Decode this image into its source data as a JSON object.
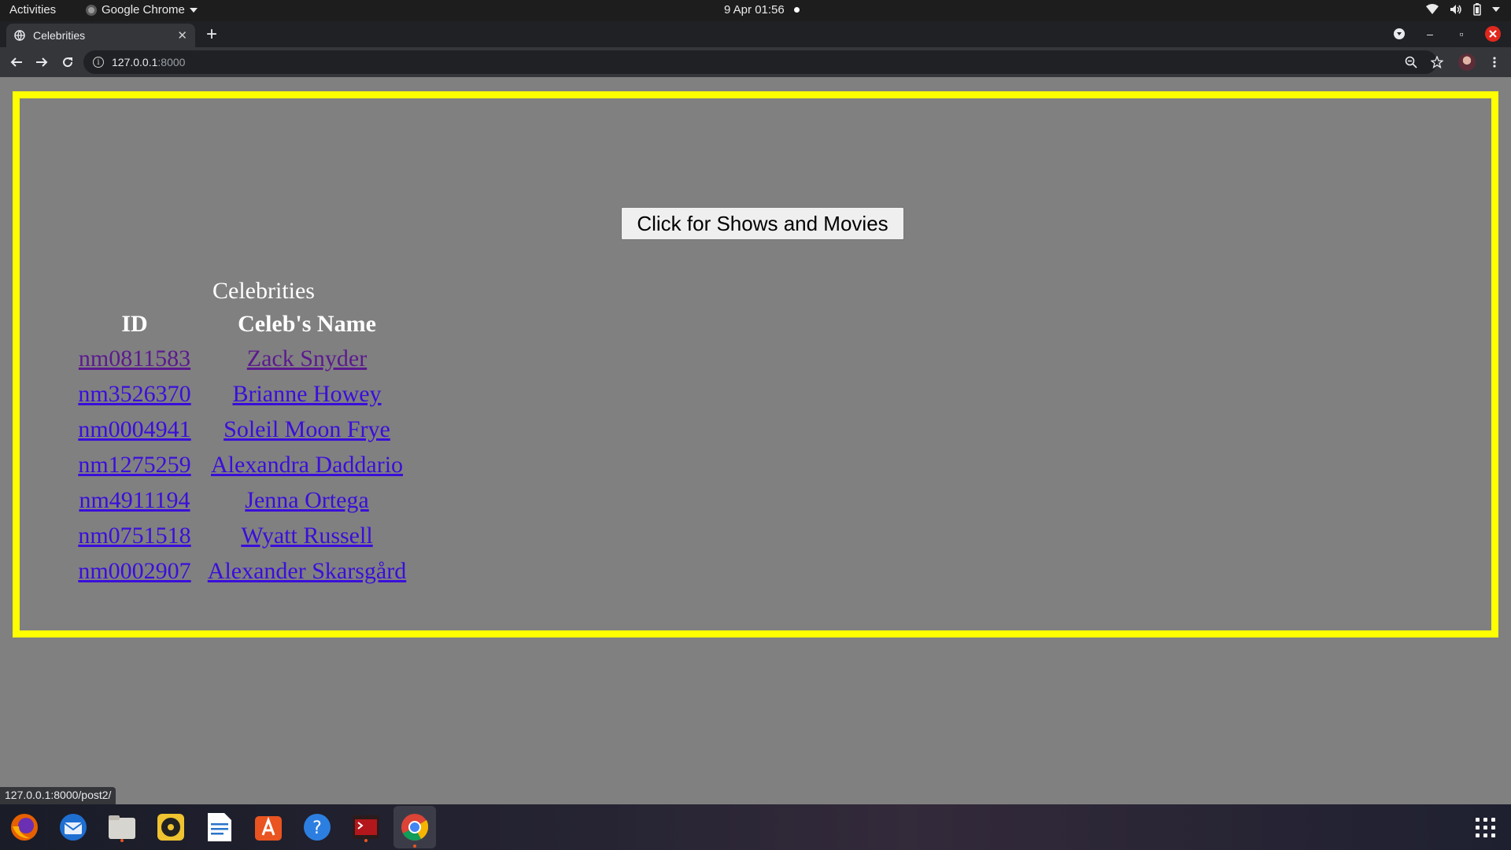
{
  "system": {
    "activities": "Activities",
    "app_menu": "Google Chrome",
    "clock": "9 Apr  01:56",
    "tray_icons": [
      "wifi-icon",
      "volume-icon",
      "battery-icon",
      "system-menu-chevron-icon"
    ]
  },
  "browser": {
    "tab_title": "Celebrities",
    "url_host": "127.0.0.1",
    "url_port": ":8000",
    "status_url": "127.0.0.1:8000/post2/"
  },
  "page": {
    "shows_button": "Click for Shows and Movies",
    "table_caption": "Celebrities",
    "columns": [
      "ID",
      "Celeb's Name"
    ],
    "rows": [
      {
        "id": "nm0811583",
        "name": "Zack Snyder"
      },
      {
        "id": "nm3526370",
        "name": "Brianne Howey"
      },
      {
        "id": "nm0004941",
        "name": "Soleil Moon Frye"
      },
      {
        "id": "nm1275259",
        "name": "Alexandra Daddario"
      },
      {
        "id": "nm4911194",
        "name": "Jenna Ortega"
      },
      {
        "id": "nm0751518",
        "name": "Wyatt Russell"
      },
      {
        "id": "nm0002907",
        "name": "Alexander Skarsgård"
      }
    ]
  },
  "dock": {
    "apps": [
      "firefox-icon",
      "thunderbird-icon",
      "files-icon",
      "rhythmbox-icon",
      "writer-icon",
      "software-icon",
      "help-icon",
      "terminal-icon",
      "chrome-icon"
    ]
  },
  "colors": {
    "page_background": "#808080",
    "frame_border": "#ffff00",
    "link": "#3a0edb",
    "visited_link": "#5b1a8e"
  }
}
